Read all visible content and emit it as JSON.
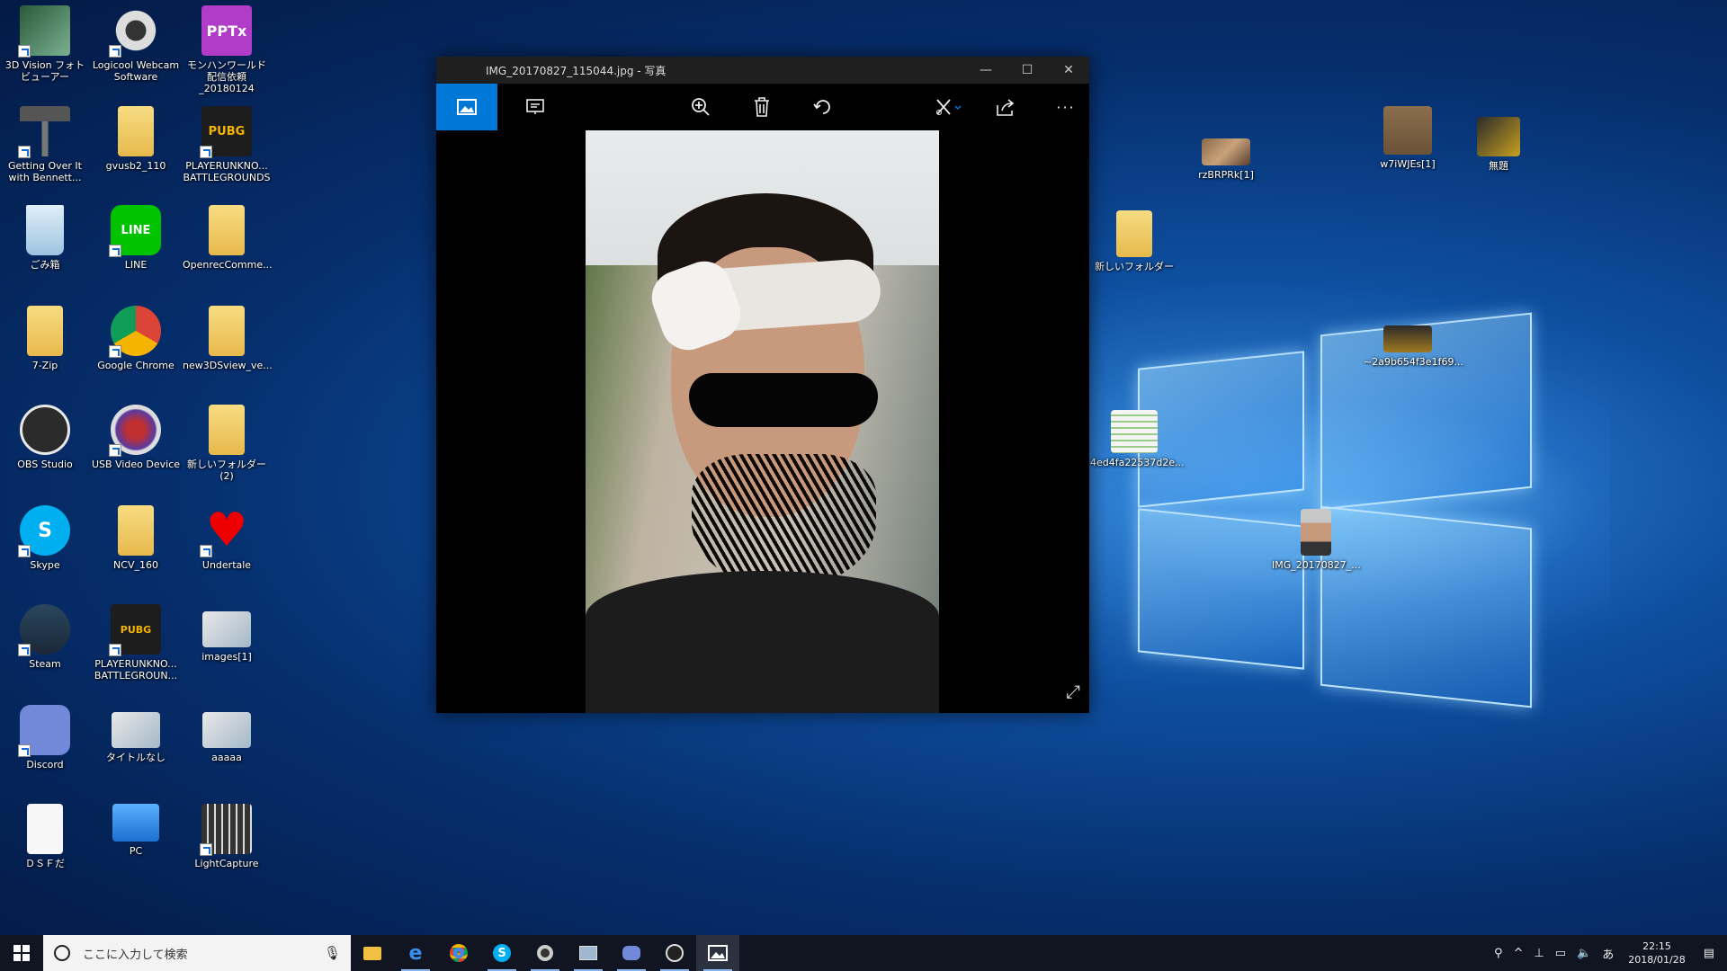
{
  "desktop_icons": [
    {
      "label": "3D Vision フォトビューアー",
      "icon": "3d-vision-icon"
    },
    {
      "label": "Logicool Webcam Software",
      "icon": "webcam-icon"
    },
    {
      "label": "モンハンワールド配信依頼_20180124",
      "icon": "pptx-icon"
    },
    {
      "label": "Getting Over It with Bennett...",
      "icon": "hammer-icon"
    },
    {
      "label": "gvusb2_110",
      "icon": "folder-icon"
    },
    {
      "label": "PLAYERUNKNO... BATTLEGROUNDS",
      "icon": "pubg-icon"
    },
    {
      "label": "ごみ箱",
      "icon": "recycle-bin-icon"
    },
    {
      "label": "LINE",
      "icon": "line-icon"
    },
    {
      "label": "OpenrecComme...",
      "icon": "folder-icon"
    },
    {
      "label": "7-Zip",
      "icon": "folder-icon"
    },
    {
      "label": "Google Chrome",
      "icon": "chrome-icon"
    },
    {
      "label": "new3DSview_ve...",
      "icon": "folder-icon"
    },
    {
      "label": "OBS Studio",
      "icon": "obs-icon"
    },
    {
      "label": "USB Video Device",
      "icon": "usb-video-icon"
    },
    {
      "label": "新しいフォルダー (2)",
      "icon": "folder-icon"
    },
    {
      "label": "Skype",
      "icon": "skype-icon"
    },
    {
      "label": "NCV_160",
      "icon": "folder-icon"
    },
    {
      "label": "Undertale",
      "icon": "heart-icon"
    },
    {
      "label": "Steam",
      "icon": "steam-icon"
    },
    {
      "label": "PLAYERUNKNO... BATTLEGROUN...",
      "icon": "pubg-test-icon"
    },
    {
      "label": "images[1]",
      "icon": "image-icon"
    },
    {
      "label": "Discord",
      "icon": "discord-icon"
    },
    {
      "label": "タイトルなし",
      "icon": "image-icon"
    },
    {
      "label": "aaaaa",
      "icon": "image-icon"
    },
    {
      "label": "ＤＳＦだ",
      "icon": "document-icon"
    },
    {
      "label": "PC",
      "icon": "pc-icon"
    },
    {
      "label": "LightCapture",
      "icon": "film-icon"
    }
  ],
  "right_icons": [
    {
      "label": "rzBRPRk[1]",
      "icon": "image-icon"
    },
    {
      "label": "w7iWJEs[1]",
      "icon": "image-icon"
    },
    {
      "label": "無題",
      "icon": "image-icon"
    },
    {
      "label": "新しいフォルダー",
      "icon": "folder-icon"
    },
    {
      "label": "~2a9b654f3e1f69...",
      "icon": "image-icon"
    },
    {
      "label": "4ed4fa22537d2e...",
      "icon": "image-icon"
    },
    {
      "label": "IMG_20170827_...",
      "icon": "image-icon"
    }
  ],
  "photos_window": {
    "title": "IMG_20170827_115044.jpg - 写真",
    "minimize": "—",
    "maximize": "☐",
    "close": "✕"
  },
  "taskbar": {
    "search_placeholder": "ここに入力して検索",
    "time": "22:15",
    "date": "2018/01/28",
    "ime": "あ"
  }
}
